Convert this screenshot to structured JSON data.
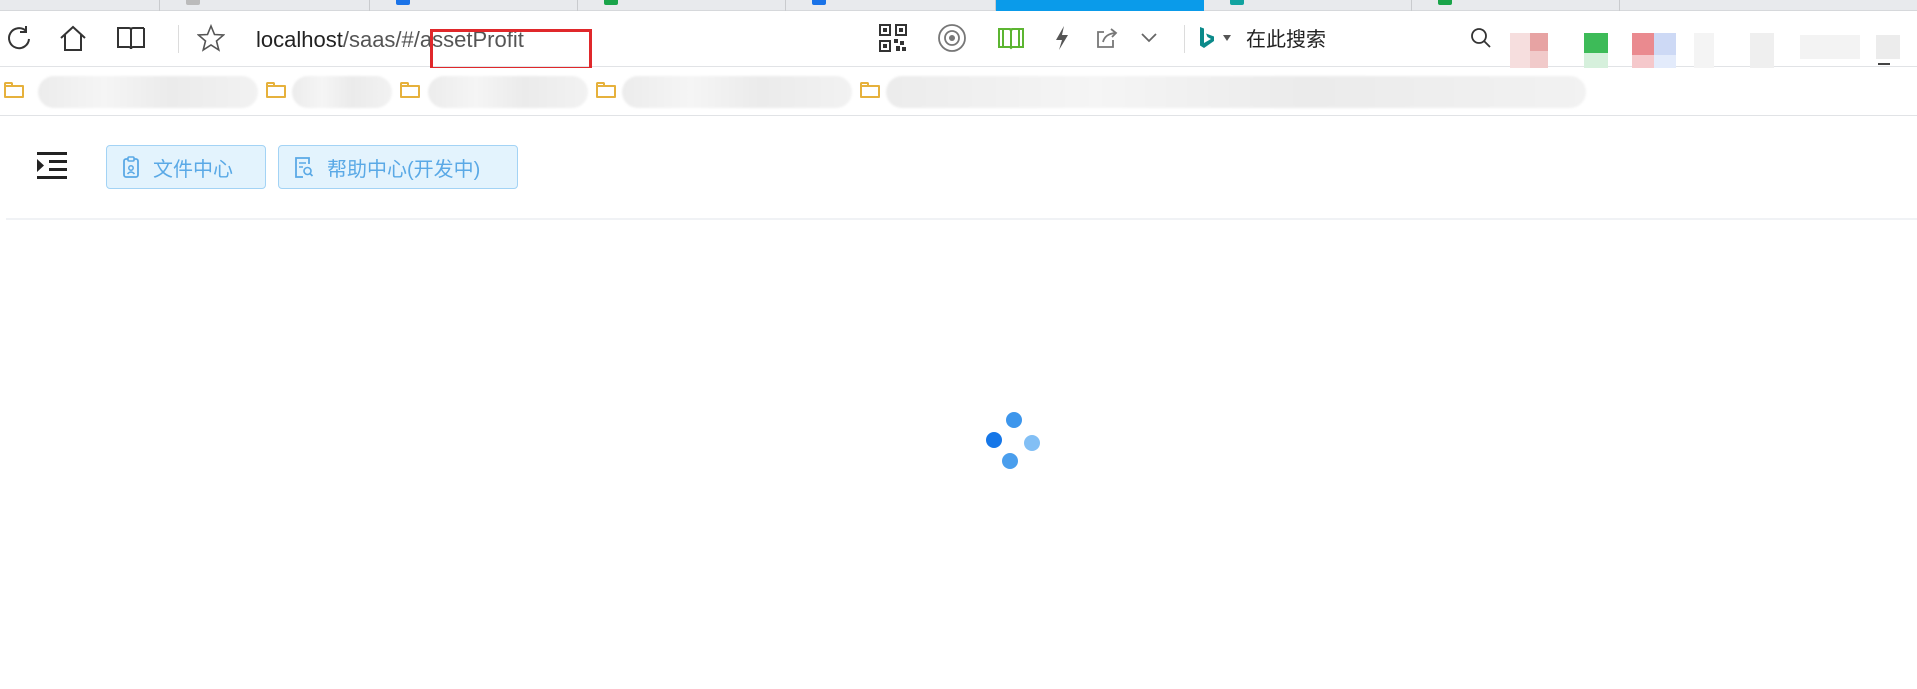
{
  "browser": {
    "address_bar": {
      "host": "localhost",
      "path": "/saas/#",
      "fragment": "/assetProfit"
    },
    "search": {
      "engine_icon": "bing-icon",
      "placeholder": "在此搜索"
    },
    "toolbar_icons": [
      "refresh-icon",
      "home-icon",
      "reader-mode-icon",
      "favorite-star-icon",
      "qr-code-icon",
      "capture-icon",
      "reading-list-icon",
      "lightning-icon",
      "share-icon",
      "chevron-down-icon",
      "search-icon"
    ],
    "highlight_color": "#e0282b"
  },
  "app": {
    "menu_toggle_icon": "indent-menu-icon",
    "header_buttons": [
      {
        "label": "文件中心",
        "icon": "file-badge-icon"
      },
      {
        "label": "帮助中心(开发中)",
        "icon": "help-doc-icon"
      }
    ],
    "accent_color": "#5aa9e6",
    "loading_spinner": "loading-dots-icon"
  }
}
